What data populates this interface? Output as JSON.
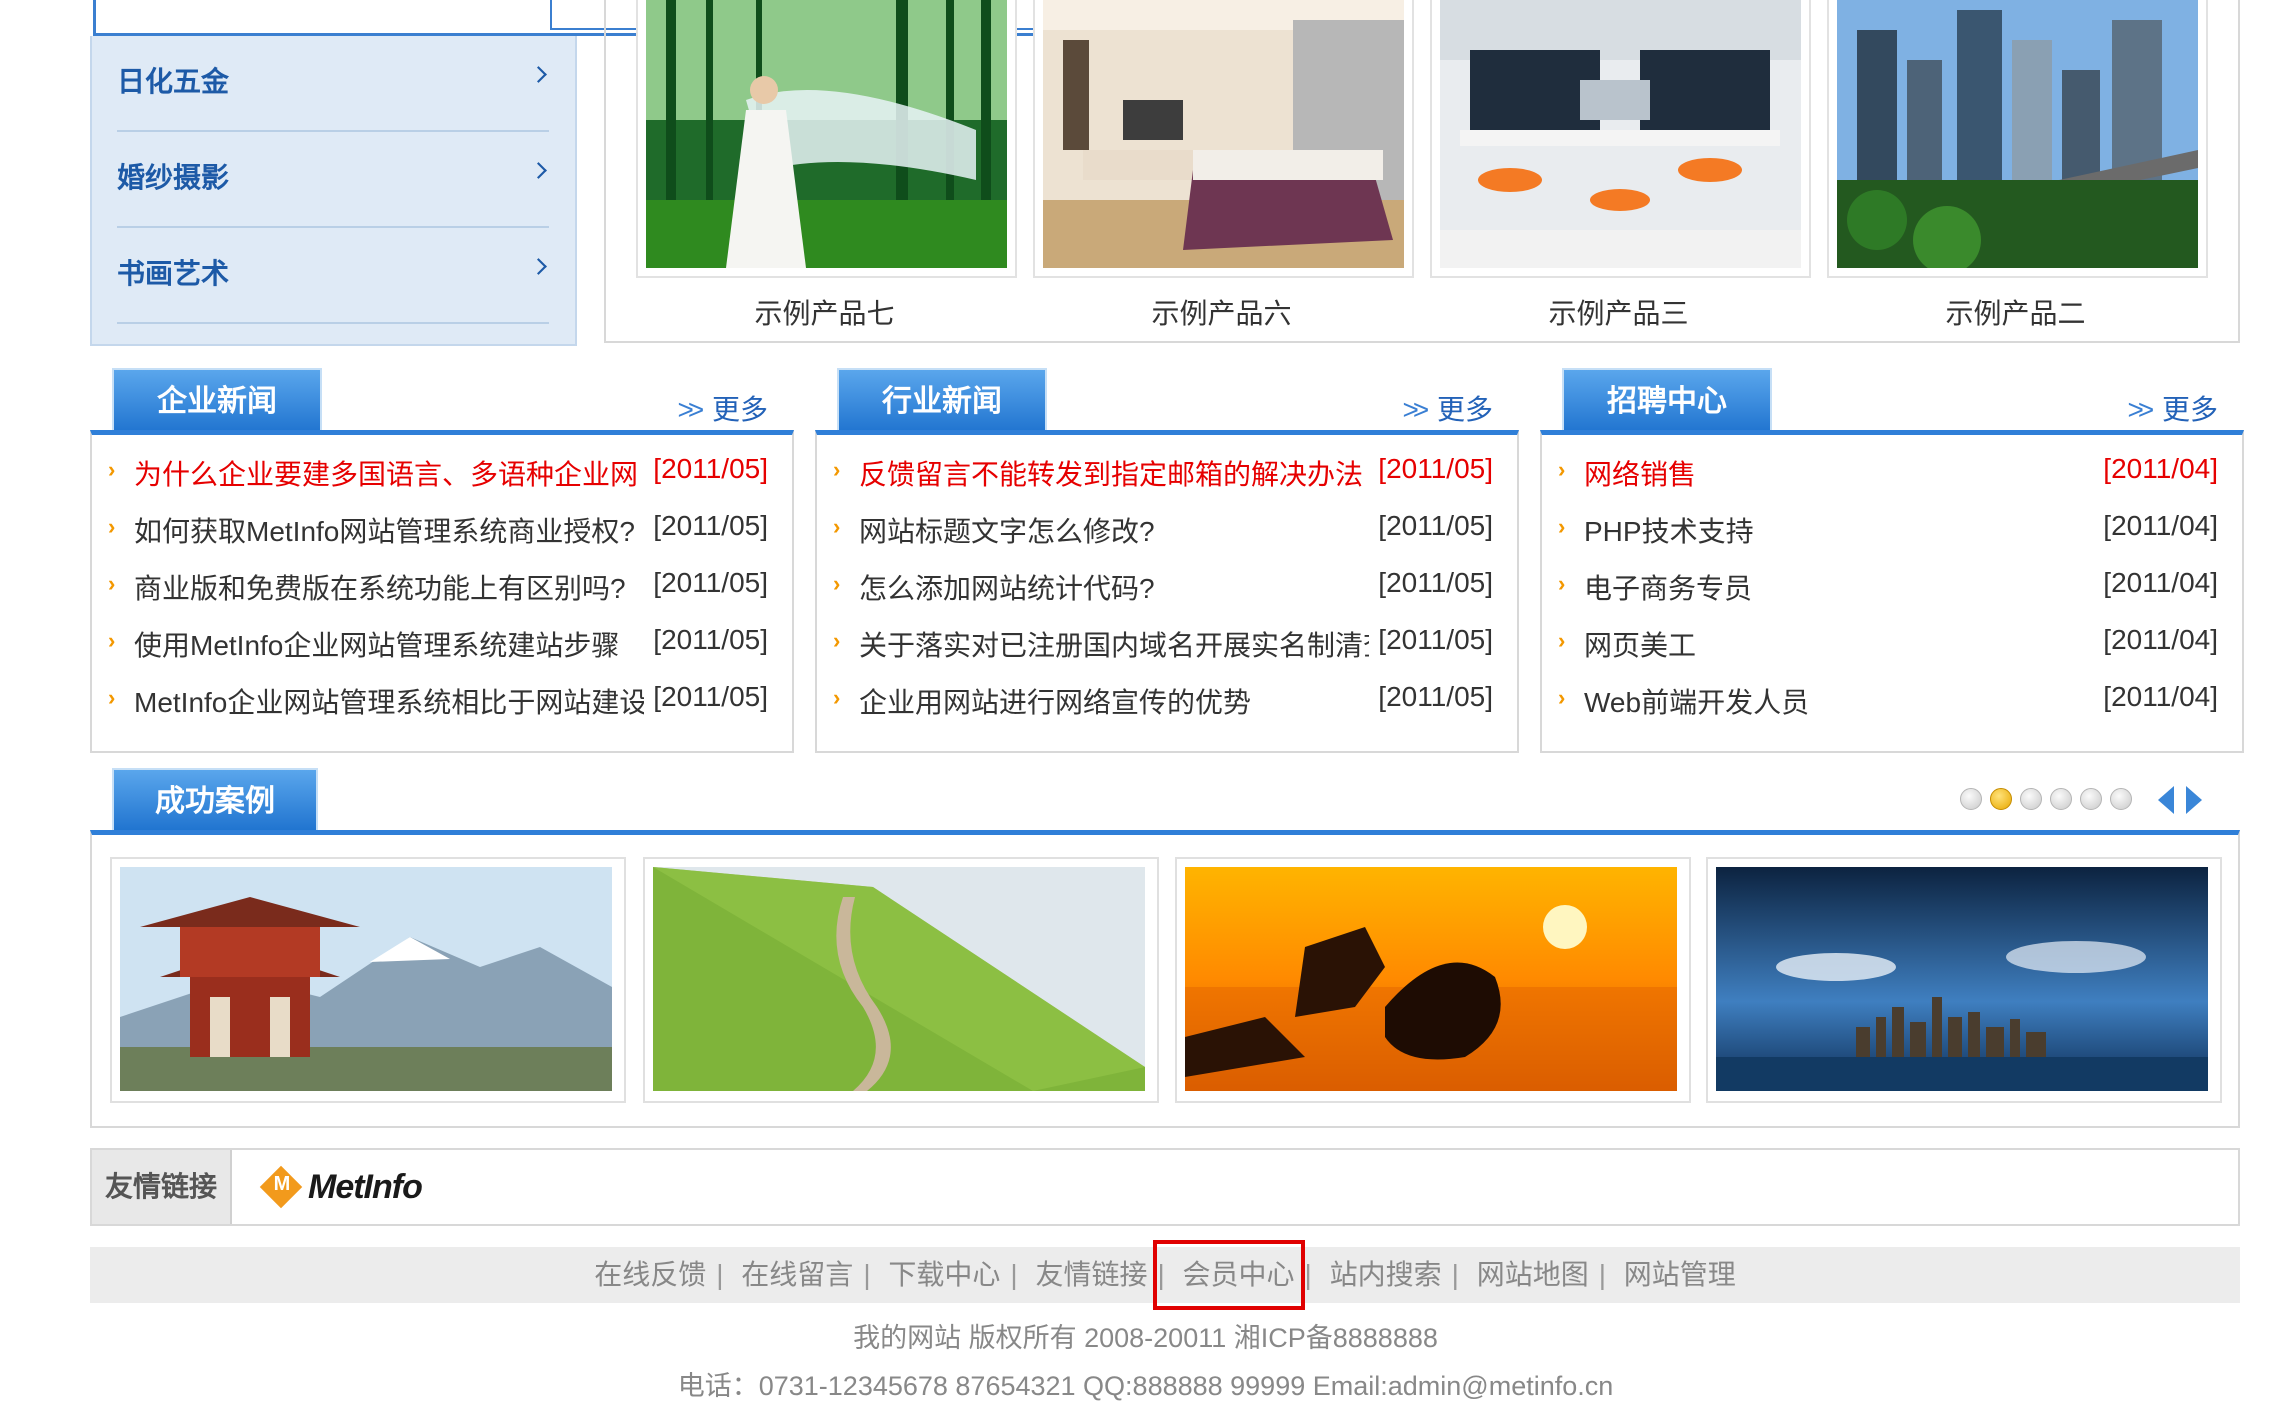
{
  "sidebar": {
    "items": [
      {
        "label": "日化五金"
      },
      {
        "label": "婚纱摄影"
      },
      {
        "label": "书画艺术"
      }
    ]
  },
  "products": [
    {
      "caption": "示例产品七",
      "image": "bride-in-bamboo-forest"
    },
    {
      "caption": "示例产品六",
      "image": "bedroom-interior"
    },
    {
      "caption": "示例产品三",
      "image": "office-workstations"
    },
    {
      "caption": "示例产品二",
      "image": "city-skyline"
    }
  ],
  "news_columns": [
    {
      "title": "企业新闻",
      "more": "更多",
      "items": [
        {
          "title": "为什么企业要建多国语言、多语种企业网",
          "date": "[2011/05]",
          "hot": true
        },
        {
          "title": "如何获取MetInfo网站管理系统商业授权?",
          "date": "[2011/05]",
          "hot": false
        },
        {
          "title": "商业版和免费版在系统功能上有区别吗?",
          "date": "[2011/05]",
          "hot": false
        },
        {
          "title": "使用MetInfo企业网站管理系统建站步骤",
          "date": "[2011/05]",
          "hot": false
        },
        {
          "title": "MetInfo企业网站管理系统相比于网站建设公",
          "date": "[2011/05]",
          "hot": false
        }
      ]
    },
    {
      "title": "行业新闻",
      "more": "更多",
      "items": [
        {
          "title": "反馈留言不能转发到指定邮箱的解决办法",
          "date": "[2011/05]",
          "hot": true
        },
        {
          "title": "网站标题文字怎么修改?",
          "date": "[2011/05]",
          "hot": false
        },
        {
          "title": "怎么添加网站统计代码?",
          "date": "[2011/05]",
          "hot": false
        },
        {
          "title": "关于落实对已注册国内域名开展实名制清查",
          "date": "[2011/05]",
          "hot": false
        },
        {
          "title": "企业用网站进行网络宣传的优势",
          "date": "[2011/05]",
          "hot": false
        }
      ]
    },
    {
      "title": "招聘中心",
      "more": "更多",
      "items": [
        {
          "title": "网络销售",
          "date": "[2011/04]",
          "hot": true
        },
        {
          "title": "PHP技术支持",
          "date": "[2011/04]",
          "hot": false
        },
        {
          "title": "电子商务专员",
          "date": "[2011/04]",
          "hot": false
        },
        {
          "title": "网页美工",
          "date": "[2011/04]",
          "hot": false
        },
        {
          "title": "Web前端开发人员",
          "date": "[2011/04]",
          "hot": false
        }
      ]
    }
  ],
  "cases": {
    "title": "成功案例",
    "pager": {
      "total": 6,
      "active": 2
    },
    "images": [
      "pagoda-mountains",
      "green-hillside-path",
      "sunset-sea-rocks",
      "city-on-horizon"
    ]
  },
  "links": {
    "label": "友情链接",
    "logo_text": "MetInfo",
    "logo_badge": "M"
  },
  "footer": {
    "nav": [
      "在线反馈",
      "在线留言",
      "下载中心",
      "友情链接",
      "会员中心",
      "站内搜索",
      "网站地图",
      "网站管理"
    ],
    "highlighted": "会员中心",
    "copyright": "我的网站 版权所有 2008-20011 湘ICP备8888888",
    "contact": "电话：0731-12345678 87654321 QQ:888888 99999 Email:admin@metinfo.cn"
  },
  "colors": {
    "accent": "#2f7fd8",
    "hot": "#e60000",
    "bullet": "#f39800",
    "highlight_box": "#e00000"
  }
}
